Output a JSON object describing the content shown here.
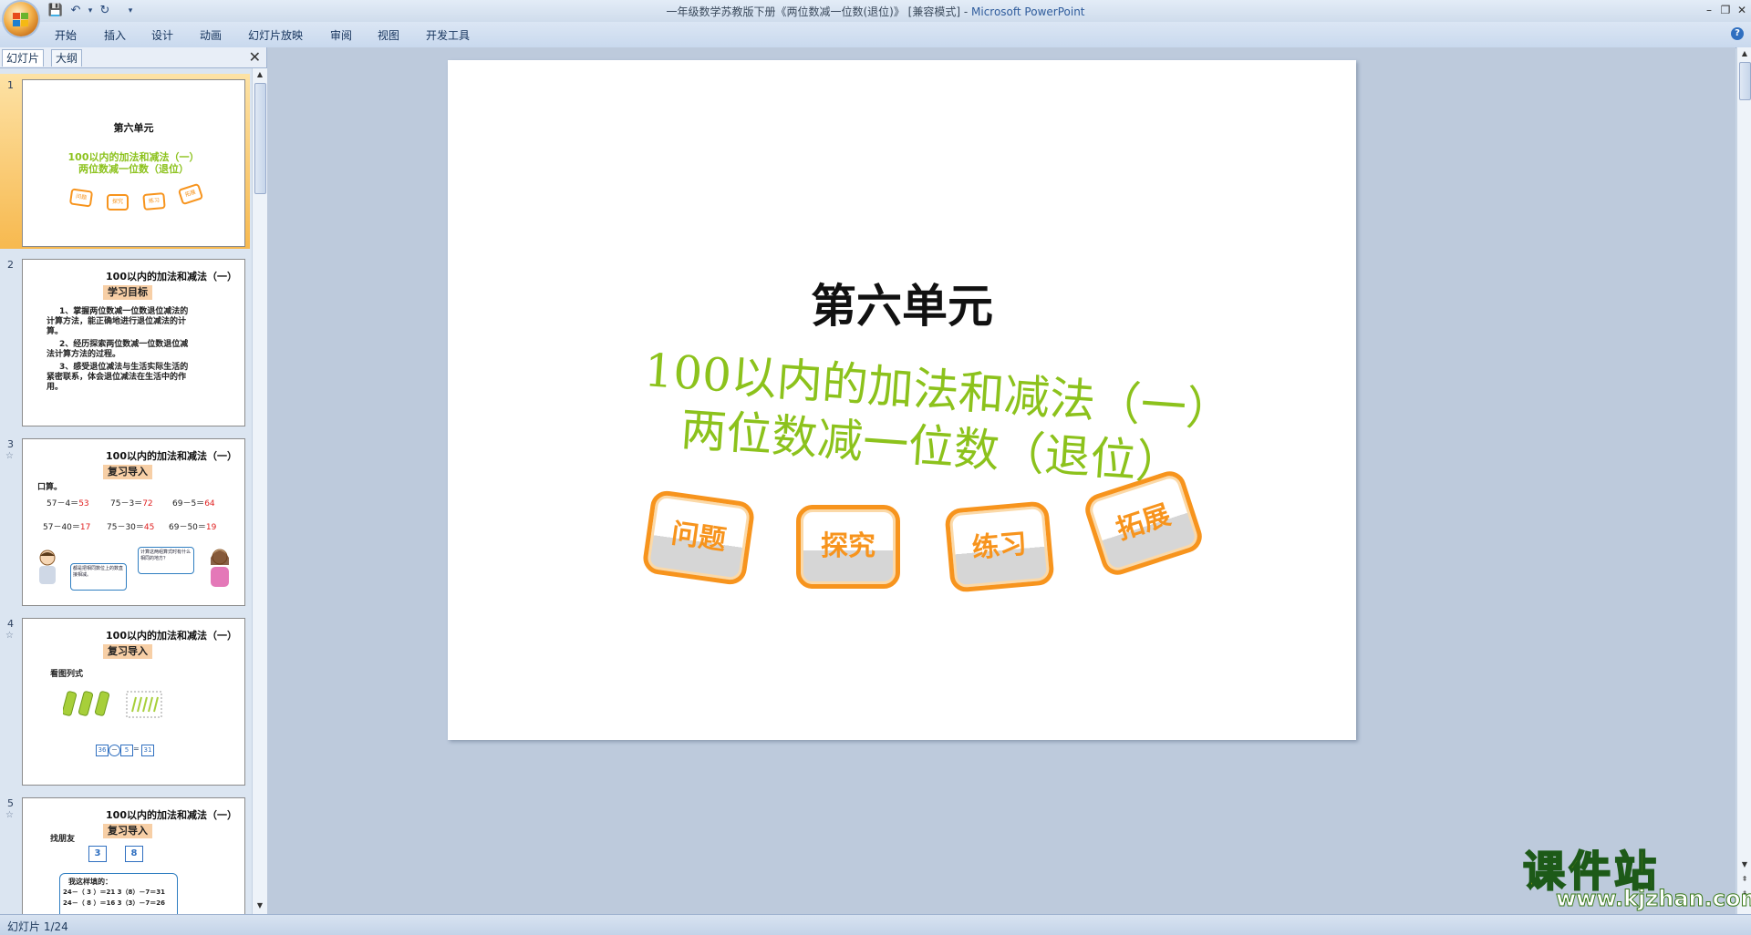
{
  "window": {
    "title": "一年级数学苏教版下册《两位数减一位数(退位)》 [兼容模式] - ",
    "app_name": "Microsoft PowerPoint"
  },
  "ribbon": {
    "tabs": [
      "开始",
      "插入",
      "设计",
      "动画",
      "幻灯片放映",
      "审阅",
      "视图",
      "开发工具"
    ]
  },
  "pane": {
    "tab_slides": "幻灯片",
    "tab_outline": "大纲",
    "close": "✕"
  },
  "thumbnails": [
    {
      "num": "1",
      "unit": "第六单元",
      "line1": "100以内的加法和减法（一）",
      "line2": "两位数减一位数（退位）",
      "buttons": [
        "问题",
        "探究",
        "练习",
        "拓展"
      ]
    },
    {
      "num": "2",
      "title": "100以内的加法和减法（一）",
      "tag": "学习目标",
      "lines": [
        "1、掌握两位数减一位数退位减法的",
        "计算方法，能正确地进行退位减法的计",
        "算。",
        "2、经历探索两位数减一位数退位减",
        "法计算方法的过程。",
        "3、感受退位减法与生活实际生活的",
        "紧密联系，体会退位减法在生活中的作",
        "用。"
      ]
    },
    {
      "num": "3",
      "title": "100以内的加法和减法（一）",
      "tag": "复习导入",
      "label": "口算。",
      "row1": [
        [
          "57－4＝",
          "53"
        ],
        [
          "75－3＝",
          "72"
        ],
        [
          "69－5＝",
          "64"
        ]
      ],
      "row2": [
        [
          "57－40＝",
          "17"
        ],
        [
          "75－30＝",
          "45"
        ],
        [
          "69－50＝",
          "19"
        ]
      ],
      "bubble1": "计算这两组算式时有什么相同的地方？",
      "bubble2": "都是把相同数位上的数直接相减。"
    },
    {
      "num": "4",
      "title": "100以内的加法和减法（一）",
      "tag": "复习导入",
      "label": "看图列式",
      "eq": [
        "36",
        "5",
        "31"
      ]
    },
    {
      "num": "5",
      "title": "100以内的加法和减法（一）",
      "tag": "复习导入",
      "label": "找朋友",
      "boxes": [
        "3",
        "8"
      ],
      "note": "我这样填的：",
      "r1": "24－（ 3 ）＝21    3（8）－7＝31",
      "r2": "24－（ 8 ）＝16    3（3）－7＝26"
    }
  ],
  "slide": {
    "unit": "第六单元",
    "title_line1": "100以内的加法和减法（一）",
    "title_line2": "两位数减一位数（退位）",
    "buttons": [
      "问题",
      "探究",
      "练习",
      "拓展"
    ]
  },
  "status": {
    "text": "幻灯片 1/24"
  },
  "watermark": {
    "title": "课件站",
    "url": "www.kjzhan.com"
  },
  "colors": {
    "title_green": "#8cc21c",
    "button_orange": "#f7941d",
    "selection": "#f7b94f"
  }
}
